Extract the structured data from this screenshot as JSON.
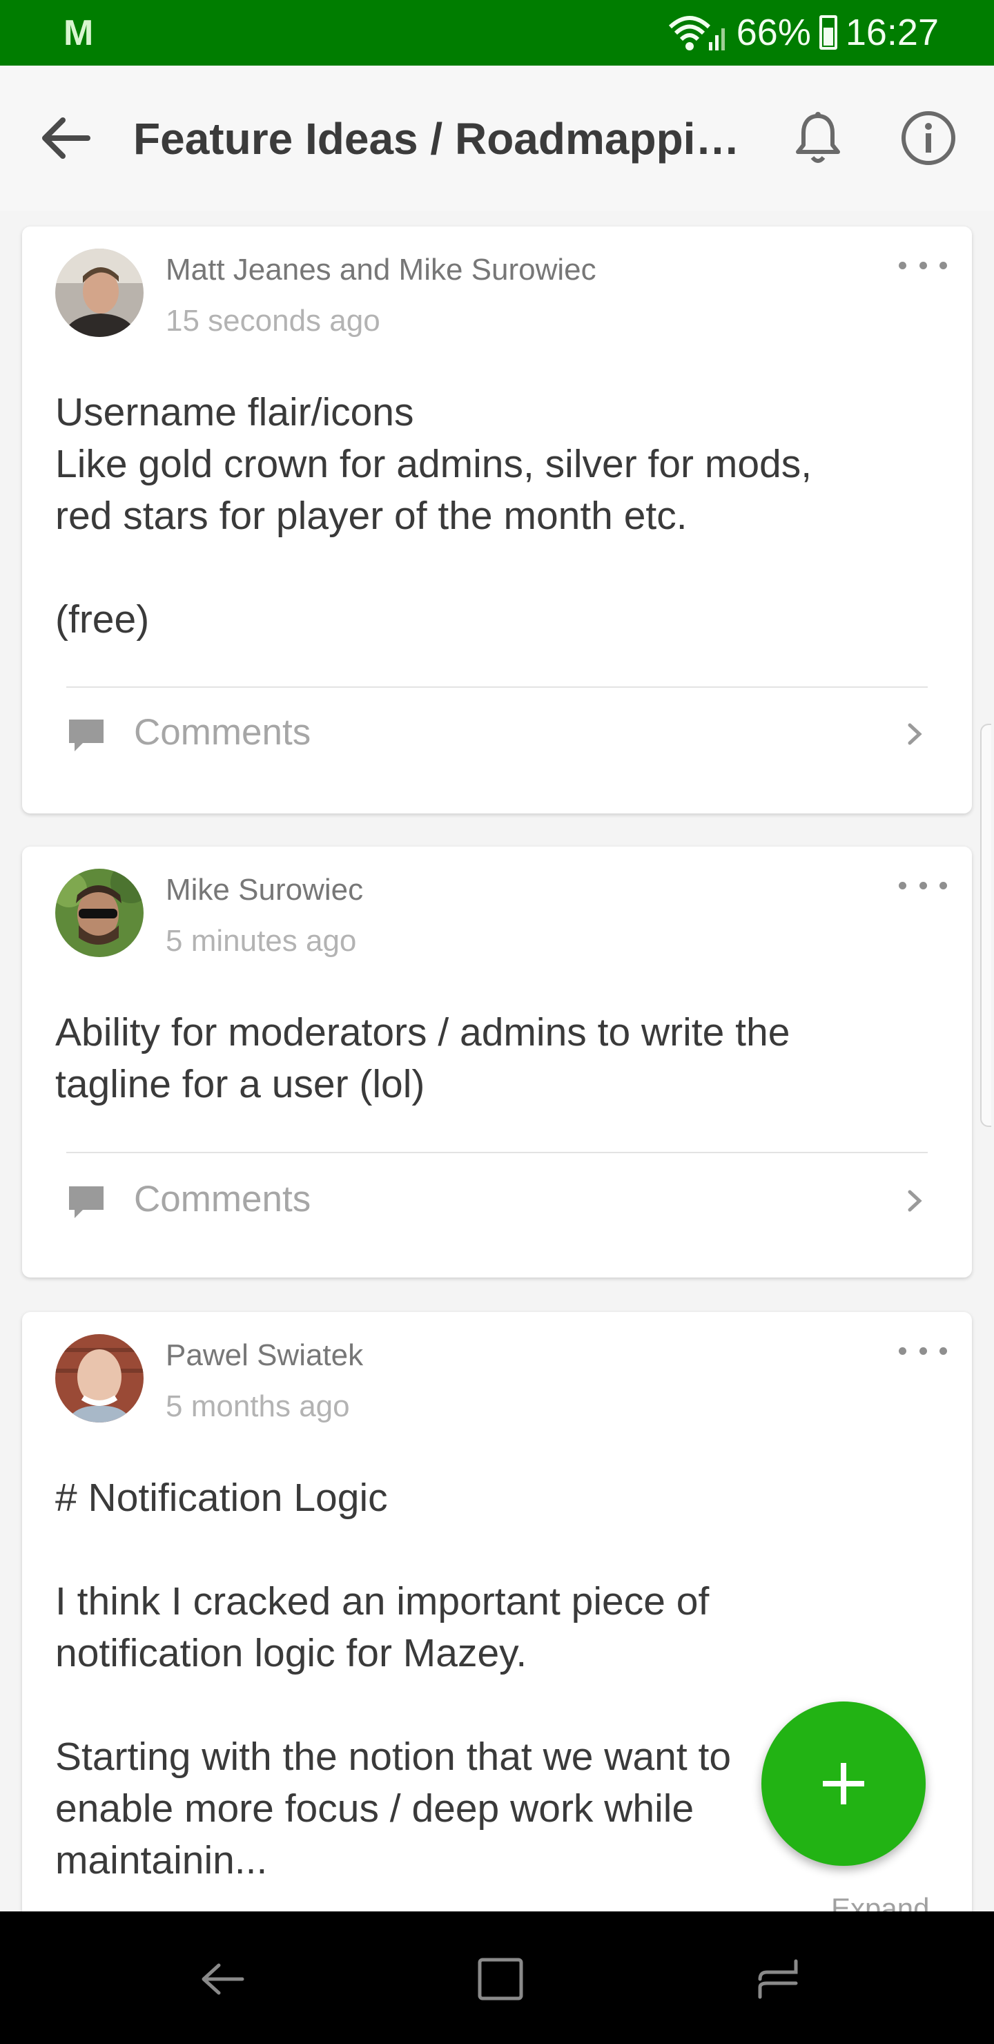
{
  "status_bar": {
    "app_icon": "M",
    "battery": "66%",
    "time": "16:27",
    "icons": [
      "wifi-icon",
      "signal-icon",
      "battery-icon"
    ]
  },
  "header": {
    "title": "Feature Ideas / Roadmappi…",
    "icons": [
      "back-arrow-icon",
      "bell-icon",
      "info-icon"
    ]
  },
  "posts": [
    {
      "author": "Matt Jeanes and Mike Surowiec",
      "time": "15 seconds ago",
      "body": "Username flair/icons\nLike gold crown for admins, silver for mods,\nred stars for player of the month etc.\n\n(free)",
      "comments_label": "Comments"
    },
    {
      "author": "Mike Surowiec",
      "time": "5 minutes ago",
      "body": "Ability for moderators / admins to write the\ntagline for a user (lol)",
      "comments_label": "Comments"
    },
    {
      "author": "Pawel Swiatek",
      "time": "5 months ago",
      "body": "# Notification Logic\n\nI think I cracked an important piece of\nnotification logic for Mazey.\n\nStarting with the notion that we want to\nenable more focus / deep work while\nmaintainin...",
      "expand_label": "Expand"
    }
  ],
  "fab": {
    "icon": "plus-icon"
  },
  "nav_bar": {
    "icons": [
      "nav-back-icon",
      "nav-home-icon",
      "nav-recents-icon"
    ]
  },
  "colors": {
    "status_bar": "#007d00",
    "fab": "#22b314",
    "nav_bar": "#000000"
  }
}
